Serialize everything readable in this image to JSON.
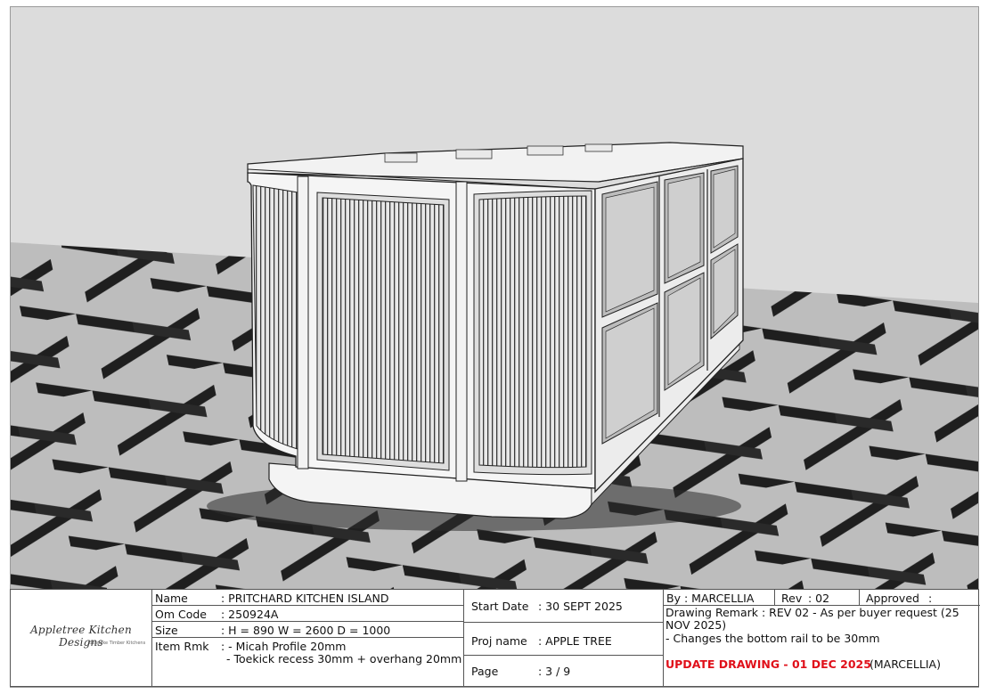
{
  "logo": {
    "name": "Appletree Kitchen Designs",
    "tagline": "Bespoke Timber Kitchens"
  },
  "fields": {
    "name_label": "Name",
    "name_value": ": PRITCHARD KITCHEN ISLAND",
    "om_label": "Om Code",
    "om_value": ": 250924A",
    "size_label": "Size",
    "size_value": ":  H = 890   W = 2600  D = 1000",
    "rmk_label": "Item Rmk",
    "rmk_line1": ": - Micah Profile 20mm",
    "rmk_line2": "- Toekick recess 30mm + overhang 20mm"
  },
  "project": {
    "start_label": "Start Date",
    "start_value": ": 30 SEPT 2025",
    "proj_label": "Proj name",
    "proj_value": ": APPLE TREE",
    "page_label": "Page",
    "page_value": ": 3 / 9"
  },
  "revision": {
    "by_label": "By",
    "by_value": ": MARCELLIA",
    "rev_label": "Rev",
    "rev_value": ": 02",
    "approved_label": "Approved",
    "approved_value": ":",
    "remark_line1": "Drawing Remark : REV 02 - As per buyer request (25",
    "remark_line2": "NOV 2025)",
    "remark_line3": "- Changes the bottom rail to be 30mm",
    "update_label": "UPDATE DRAWING - 01 DEC 2025",
    "update_by": "(MARCELLIA)"
  },
  "colors": {
    "wall": "#dcdcdc",
    "tile_light": "#b9b9b9",
    "tile_dark": "#1e1e1e",
    "cabinet_panel": "#cfcfcf",
    "accent_red": "#e0101a"
  }
}
